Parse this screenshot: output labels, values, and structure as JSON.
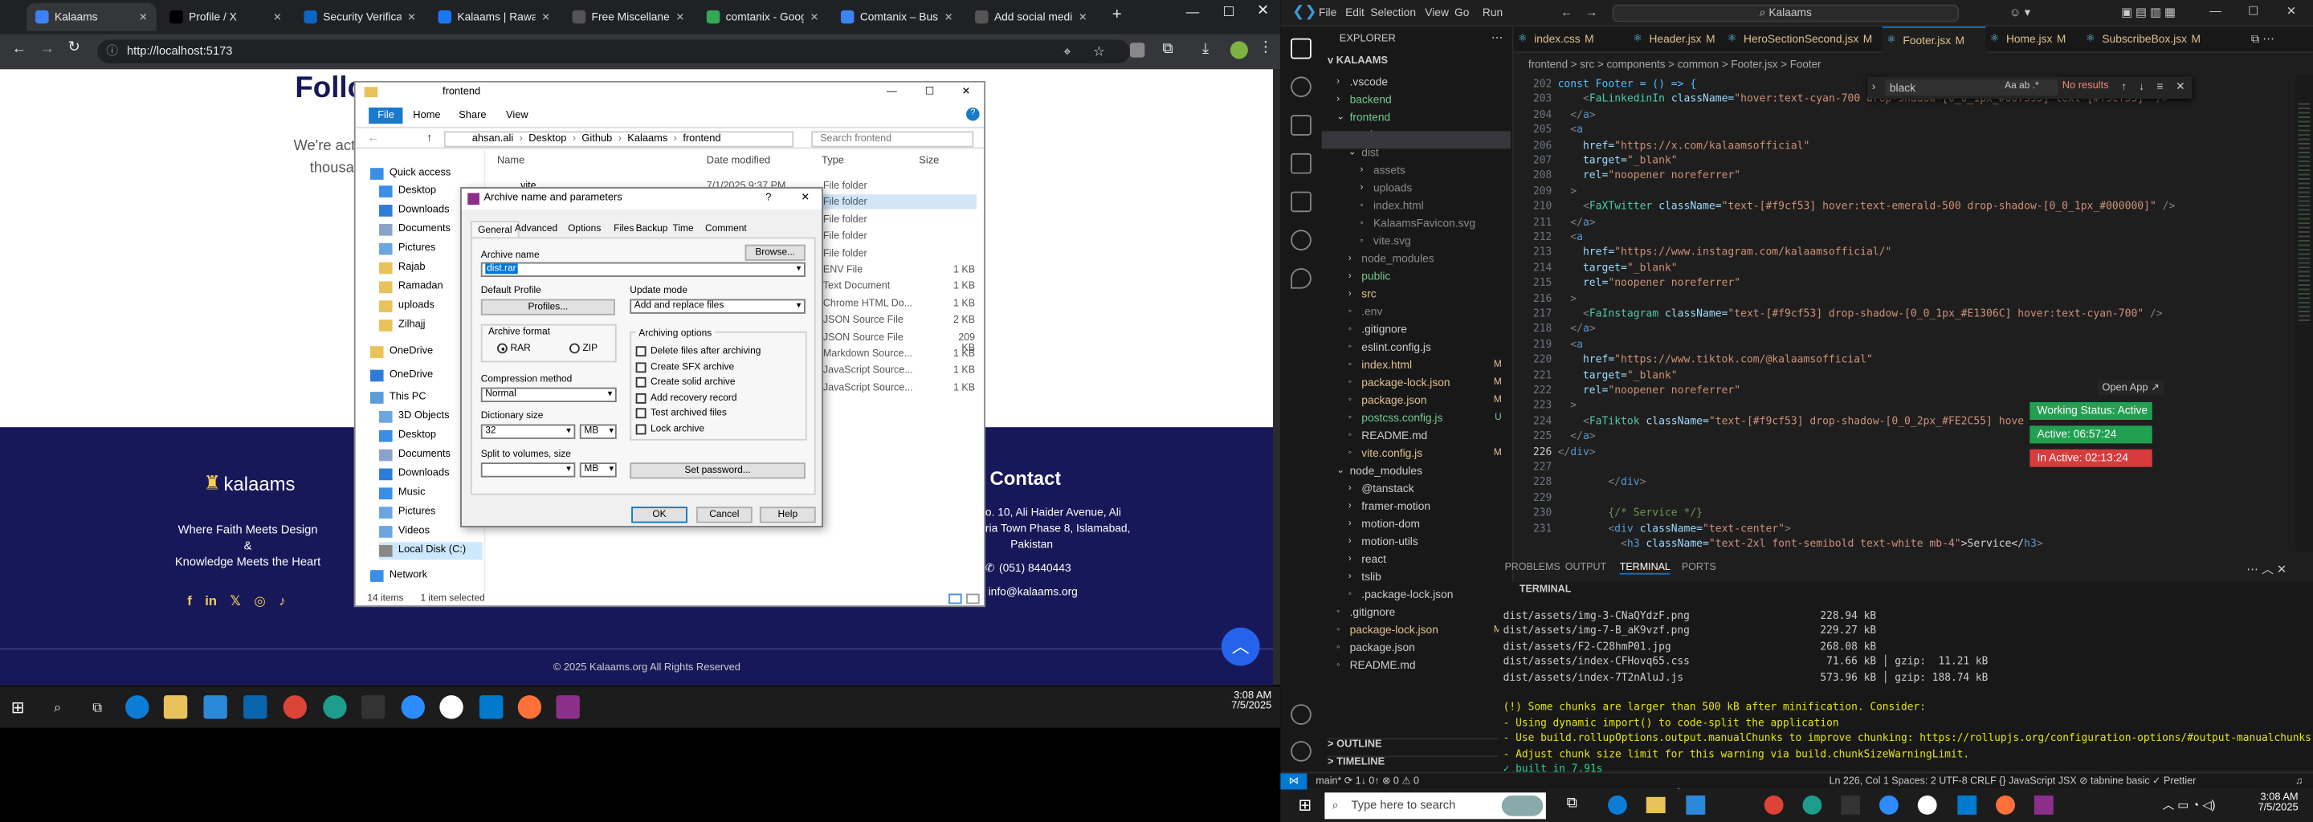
{
  "browser": {
    "tabs": [
      {
        "label": "Kalaams",
        "color": "#3b82f6"
      },
      {
        "label": "Profile / X",
        "color": "#000000"
      },
      {
        "label": "Security Verificati",
        "color": "#0a66c2"
      },
      {
        "label": "Kalaams | Rawalp",
        "color": "#1877f2"
      },
      {
        "label": "Free Miscellaneou",
        "color": "#555555"
      },
      {
        "label": "comtanix - Googl",
        "color": "#34a853"
      },
      {
        "label": "Comtanix – Busin",
        "color": "#3b82f6"
      },
      {
        "label": "Add social media",
        "color": "#555555"
      }
    ],
    "url": "http://localhost:5173",
    "page": {
      "heading_fragment": "Follo",
      "sub_fragment_1": "We're act",
      "sub_fragment_2": "thousa",
      "brand": "kalaams",
      "tagline_1": "Where Faith Meets Design",
      "tagline_2": "&",
      "tagline_3": "Knowledge Meets the Heart",
      "contact_title": "Contact",
      "address_1": "o. 10, Ali Haider Avenue, Ali",
      "address_2": "ria Town Phase 8, Islamabad,",
      "address_3": "Pakistan",
      "phone": "(051) 8440443",
      "email": "info@kalaams.org",
      "copyright": "© 2025 Kalaams.org All Rights Reserved"
    },
    "taskbar": {
      "time": "3:08 AM",
      "date": "7/5/2025"
    }
  },
  "explorer": {
    "title": "frontend",
    "ribbon": [
      "File",
      "Home",
      "Share",
      "View"
    ],
    "path": [
      "ahsan.ali",
      "Desktop",
      "Github",
      "Kalaams",
      "frontend"
    ],
    "search_placeholder": "Search frontend",
    "nav": [
      {
        "label": "Quick access",
        "color": "#3a8ee6"
      },
      {
        "label": "Desktop",
        "color": "#3a8ee6"
      },
      {
        "label": "Downloads",
        "color": "#2f7bd8"
      },
      {
        "label": "Documents",
        "color": "#8aa4c8"
      },
      {
        "label": "Pictures",
        "color": "#6ca6e0"
      },
      {
        "label": "Rajab",
        "color": "#e8c25a"
      },
      {
        "label": "Ramadan",
        "color": "#e8c25a"
      },
      {
        "label": "uploads",
        "color": "#e8c25a"
      },
      {
        "label": "Zilhajj",
        "color": "#e8c25a"
      },
      {
        "label": "OneDrive",
        "color": "#e8c25a"
      },
      {
        "label": "OneDrive",
        "color": "#2f7bd8"
      },
      {
        "label": "This PC",
        "color": "#5a9bd8"
      },
      {
        "label": "3D Objects",
        "color": "#6ca6e0"
      },
      {
        "label": "Desktop",
        "color": "#3a8ee6"
      },
      {
        "label": "Documents",
        "color": "#8aa4c8"
      },
      {
        "label": "Downloads",
        "color": "#2f7bd8"
      },
      {
        "label": "Music",
        "color": "#3a8ee6"
      },
      {
        "label": "Pictures",
        "color": "#6ca6e0"
      },
      {
        "label": "Videos",
        "color": "#6ca6e0"
      },
      {
        "label": "Local Disk (C:)",
        "color": "#888888"
      },
      {
        "label": "Network",
        "color": "#3a8ee6"
      }
    ],
    "columns": [
      "Name",
      "Date modified",
      "Type",
      "Size"
    ],
    "first_row": {
      "name": ".vite",
      "date": "7/1/2025 9:37 PM"
    },
    "types": [
      "File folder",
      "File folder",
      "File folder",
      "File folder",
      "File folder",
      "ENV File",
      "Text Document",
      "Chrome HTML Do...",
      "JSON Source File",
      "JSON Source File",
      "Markdown Source...",
      "JavaScript Source...",
      "JavaScript Source..."
    ],
    "sizes": [
      "",
      "",
      "",
      "",
      "",
      "1 KB",
      "1 KB",
      "1 KB",
      "2 KB",
      "209 KB",
      "1 KB",
      "1 KB",
      "1 KB"
    ],
    "status_items": "14 items",
    "status_selected": "1 item selected"
  },
  "dialog": {
    "title": "Archive name and parameters",
    "tabs": [
      "General",
      "Advanced",
      "Options",
      "Files",
      "Backup",
      "Time",
      "Comment"
    ],
    "archive_name_label": "Archive name",
    "archive_name": "dist.rar",
    "browse": "Browse...",
    "default_profile": "Default Profile",
    "profiles": "Profiles...",
    "update_mode_label": "Update mode",
    "update_mode": "Add and replace files",
    "archive_format_label": "Archive format",
    "format_rar": "RAR",
    "format_zip": "ZIP",
    "compression_label": "Compression method",
    "compression": "Normal",
    "dict_label": "Dictionary size",
    "dict_value": "32",
    "dict_unit": "MB",
    "split_label": "Split to volumes, size",
    "split_unit": "MB",
    "options_label": "Archiving options",
    "options": [
      "Delete files after archiving",
      "Create SFX archive",
      "Create solid archive",
      "Add recovery record",
      "Test archived files",
      "Lock archive"
    ],
    "set_password": "Set password...",
    "ok": "OK",
    "cancel": "Cancel",
    "help": "Help"
  },
  "vscode": {
    "menu": [
      "File",
      "Edit",
      "Selection",
      "View",
      "Go",
      "Run"
    ],
    "search_text": "Kalaams",
    "explorer_title": "EXPLORER",
    "root": "KALAAMS",
    "tree": [
      {
        "label": ".vscode",
        "indent": 1,
        "arrow": ">",
        "color": "#cccccc",
        "badge": ""
      },
      {
        "label": "backend",
        "indent": 1,
        "arrow": ">",
        "color": "#73c991",
        "badge": ""
      },
      {
        "label": "frontend",
        "indent": 1,
        "arrow": "v",
        "color": "#73c991",
        "badge": ""
      },
      {
        "label": ".vite",
        "indent": 2,
        "arrow": ">",
        "color": "#cccccc",
        "badge": ""
      },
      {
        "label": "dist",
        "indent": 2,
        "arrow": "v",
        "color": "#8c8c8c",
        "badge": ""
      },
      {
        "label": "assets",
        "indent": 3,
        "arrow": ">",
        "color": "#8c8c8c",
        "badge": ""
      },
      {
        "label": "uploads",
        "indent": 3,
        "arrow": ">",
        "color": "#8c8c8c",
        "badge": ""
      },
      {
        "label": "index.html",
        "indent": 3,
        "arrow": "",
        "color": "#8c8c8c",
        "badge": ""
      },
      {
        "label": "KalaamsFavicon.svg",
        "indent": 3,
        "arrow": "",
        "color": "#8c8c8c",
        "badge": ""
      },
      {
        "label": "vite.svg",
        "indent": 3,
        "arrow": "",
        "color": "#8c8c8c",
        "badge": ""
      },
      {
        "label": "node_modules",
        "indent": 2,
        "arrow": ">",
        "color": "#8c8c8c",
        "badge": ""
      },
      {
        "label": "public",
        "indent": 2,
        "arrow": ">",
        "color": "#73c991",
        "badge": ""
      },
      {
        "label": "src",
        "indent": 2,
        "arrow": ">",
        "color": "#e2c08d",
        "badge": ""
      },
      {
        "label": ".env",
        "indent": 2,
        "arrow": "",
        "color": "#8c8c8c",
        "badge": ""
      },
      {
        "label": ".gitignore",
        "indent": 2,
        "arrow": "",
        "color": "#cccccc",
        "badge": ""
      },
      {
        "label": "eslint.config.js",
        "indent": 2,
        "arrow": "",
        "color": "#cccccc",
        "badge": ""
      },
      {
        "label": "index.html",
        "indent": 2,
        "arrow": "",
        "color": "#e2c08d",
        "badge": "M"
      },
      {
        "label": "package-lock.json",
        "indent": 2,
        "arrow": "",
        "color": "#e2c08d",
        "badge": "M"
      },
      {
        "label": "package.json",
        "indent": 2,
        "arrow": "",
        "color": "#e2c08d",
        "badge": "M"
      },
      {
        "label": "postcss.config.js",
        "indent": 2,
        "arrow": "",
        "color": "#73c991",
        "badge": "U"
      },
      {
        "label": "README.md",
        "indent": 2,
        "arrow": "",
        "color": "#cccccc",
        "badge": ""
      },
      {
        "label": "vite.config.js",
        "indent": 2,
        "arrow": "",
        "color": "#e2c08d",
        "badge": "M"
      },
      {
        "label": "node_modules",
        "indent": 1,
        "arrow": "v",
        "color": "#cccccc",
        "badge": ""
      },
      {
        "label": "@tanstack",
        "indent": 2,
        "arrow": ">",
        "color": "#cccccc",
        "badge": ""
      },
      {
        "label": "framer-motion",
        "indent": 2,
        "arrow": ">",
        "color": "#cccccc",
        "badge": ""
      },
      {
        "label": "motion-dom",
        "indent": 2,
        "arrow": ">",
        "color": "#cccccc",
        "badge": ""
      },
      {
        "label": "motion-utils",
        "indent": 2,
        "arrow": ">",
        "color": "#cccccc",
        "badge": ""
      },
      {
        "label": "react",
        "indent": 2,
        "arrow": ">",
        "color": "#cccccc",
        "badge": ""
      },
      {
        "label": "tslib",
        "indent": 2,
        "arrow": ">",
        "color": "#cccccc",
        "badge": ""
      },
      {
        "label": ".package-lock.json",
        "indent": 2,
        "arrow": "",
        "color": "#cccccc",
        "badge": ""
      },
      {
        "label": ".gitignore",
        "indent": 1,
        "arrow": "",
        "color": "#cccccc",
        "badge": ""
      },
      {
        "label": "package-lock.json",
        "indent": 1,
        "arrow": "",
        "color": "#e2c08d",
        "badge": "M"
      },
      {
        "label": "package.json",
        "indent": 1,
        "arrow": "",
        "color": "#cccccc",
        "badge": ""
      },
      {
        "label": "README.md",
        "indent": 1,
        "arrow": "",
        "color": "#cccccc",
        "badge": ""
      }
    ],
    "outline": "OUTLINE",
    "timeline": "TIMELINE",
    "editor_tabs": [
      {
        "label": "index.css",
        "badge": "M"
      },
      {
        "label": "Header.jsx",
        "badge": "M"
      },
      {
        "label": "HeroSectionSecond.jsx",
        "badge": "M"
      },
      {
        "label": "Footer.jsx",
        "badge": "M"
      },
      {
        "label": "Home.jsx",
        "badge": "M"
      },
      {
        "label": "SubscribeBox.jsx",
        "badge": "M"
      }
    ],
    "breadcrumb": "frontend > src > components > common > Footer.jsx > Footer",
    "find_text": "black",
    "find_result": "No results",
    "line_numbers": [
      "202",
      "203",
      "204",
      "205",
      "206",
      "207",
      "208",
      "209",
      "210",
      "211",
      "212",
      "213",
      "214",
      "215",
      "216",
      "217",
      "218",
      "219",
      "220",
      "221",
      "222",
      "223",
      "224",
      "225",
      "226",
      "227",
      "228",
      "229",
      "230",
      "231"
    ],
    "code_lines": [
      [
        [
          "const Footer = () => {",
          "#4fc1ff"
        ]
      ],
      [
        [
          "    <",
          "#808080"
        ],
        [
          "FaLinkedinIn ",
          "#4ec9b0"
        ],
        [
          "className=",
          "#9cdcfe"
        ],
        [
          "\"hover:text-cyan-700 drop-shadow-[0_0_1px_#007595] text-[#f9cf53]\"",
          "#ce9178"
        ],
        [
          " />",
          "#808080"
        ]
      ],
      [
        [
          "  </",
          "#808080"
        ],
        [
          "a",
          "#569cd6"
        ],
        [
          ">",
          "#808080"
        ]
      ],
      [
        [
          "  <",
          "#808080"
        ],
        [
          "a",
          "#569cd6"
        ]
      ],
      [
        [
          "    href=",
          "#9cdcfe"
        ],
        [
          "\"https://x.com/kalaamsofficial\"",
          "#ce9178"
        ]
      ],
      [
        [
          "    target=",
          "#9cdcfe"
        ],
        [
          "\"_blank\"",
          "#ce9178"
        ]
      ],
      [
        [
          "    rel=",
          "#9cdcfe"
        ],
        [
          "\"noopener noreferrer\"",
          "#ce9178"
        ]
      ],
      [
        [
          "  >",
          "#808080"
        ]
      ],
      [
        [
          "    <",
          "#808080"
        ],
        [
          "FaXTwitter ",
          "#4ec9b0"
        ],
        [
          "className=",
          "#9cdcfe"
        ],
        [
          "\"text-[#f9cf53] hover:text-emerald-500 drop-shadow-[0_0_1px_#000000]\"",
          "#ce9178"
        ],
        [
          " />",
          "#808080"
        ]
      ],
      [
        [
          "  </",
          "#808080"
        ],
        [
          "a",
          "#569cd6"
        ],
        [
          ">",
          "#808080"
        ]
      ],
      [
        [
          "  <",
          "#808080"
        ],
        [
          "a",
          "#569cd6"
        ]
      ],
      [
        [
          "    href=",
          "#9cdcfe"
        ],
        [
          "\"https://www.instagram.com/kalaamsofficial/\"",
          "#ce9178"
        ]
      ],
      [
        [
          "    target=",
          "#9cdcfe"
        ],
        [
          "\"_blank\"",
          "#ce9178"
        ]
      ],
      [
        [
          "    rel=",
          "#9cdcfe"
        ],
        [
          "\"noopener noreferrer\"",
          "#ce9178"
        ]
      ],
      [
        [
          "  >",
          "#808080"
        ]
      ],
      [
        [
          "    <",
          "#808080"
        ],
        [
          "FaInstagram ",
          "#4ec9b0"
        ],
        [
          "className=",
          "#9cdcfe"
        ],
        [
          "\"text-[#f9cf53] drop-shadow-[0_0_1px_#E1306C] hover:text-cyan-700\"",
          "#ce9178"
        ],
        [
          " />",
          "#808080"
        ]
      ],
      [
        [
          "  </",
          "#808080"
        ],
        [
          "a",
          "#569cd6"
        ],
        [
          ">",
          "#808080"
        ]
      ],
      [
        [
          "  <",
          "#808080"
        ],
        [
          "a",
          "#569cd6"
        ]
      ],
      [
        [
          "    href=",
          "#9cdcfe"
        ],
        [
          "\"https://www.tiktok.com/@kalaamsofficial\"",
          "#ce9178"
        ]
      ],
      [
        [
          "    target=",
          "#9cdcfe"
        ],
        [
          "\"_blank\"",
          "#ce9178"
        ]
      ],
      [
        [
          "    rel=",
          "#9cdcfe"
        ],
        [
          "\"noopener noreferrer\"",
          "#ce9178"
        ]
      ],
      [
        [
          "  >",
          "#808080"
        ]
      ],
      [
        [
          "    <",
          "#808080"
        ],
        [
          "FaTiktok ",
          "#4ec9b0"
        ],
        [
          "className=",
          "#9cdcfe"
        ],
        [
          "\"text-[#f9cf53] drop-shadow-[0_0_2px_#FE2C55] hove",
          "#ce9178"
        ]
      ],
      [
        [
          "  </",
          "#808080"
        ],
        [
          "a",
          "#569cd6"
        ],
        [
          ">",
          "#808080"
        ]
      ],
      [
        [
          "</",
          "#808080"
        ],
        [
          "div",
          "#569cd6"
        ],
        [
          ">",
          "#808080"
        ]
      ],
      [
        [
          "",
          "#d4d4d4"
        ]
      ],
      [
        [
          "        </",
          "#808080"
        ],
        [
          "div",
          "#569cd6"
        ],
        [
          ">",
          "#808080"
        ]
      ],
      [
        [
          "",
          "#d4d4d4"
        ]
      ],
      [
        [
          "        {/* Service */}",
          "#6a9955"
        ]
      ],
      [
        [
          "        <",
          "#808080"
        ],
        [
          "div ",
          "#569cd6"
        ],
        [
          "className=",
          "#9cdcfe"
        ],
        [
          "\"text-center\"",
          "#ce9178"
        ],
        [
          ">",
          "#808080"
        ]
      ],
      [
        [
          "          <",
          "#808080"
        ],
        [
          "h3 ",
          "#569cd6"
        ],
        [
          "className=",
          "#9cdcfe"
        ],
        [
          "\"text-2xl font-semibold text-white mb-4\"",
          "#ce9178"
        ],
        [
          ">Service</",
          "#d4d4d4"
        ],
        [
          "h3",
          "#569cd6"
        ],
        [
          ">",
          "#808080"
        ]
      ]
    ],
    "open_app": "Open App",
    "working_status": "Working Status: Active",
    "active_time": "Active: 06:57:24",
    "inactive_time": "In Active: 02:13:24",
    "panel_tabs": [
      "PROBLEMS",
      "OUTPUT",
      "TERMINAL",
      "PORTS"
    ],
    "terminal_section": "TERMINAL",
    "terminal_lines": [
      {
        "text": "dist/assets/img-3-CNaQYdzF.png                     228.94 kB",
        "color": "#cccccc"
      },
      {
        "text": "dist/assets/img-7-B_aK9vzf.png                     229.27 kB",
        "color": "#cccccc"
      },
      {
        "text": "dist/assets/F2-C28hmP01.jpg                        268.08 kB",
        "color": "#cccccc"
      },
      {
        "text": "dist/assets/index-CFHovq65.css                      71.66 kB │ gzip:  11.21 kB",
        "color": "#cccccc"
      },
      {
        "text": "dist/assets/index-7T2nAluJ.js                      573.96 kB │ gzip: 188.74 kB",
        "color": "#cccccc"
      },
      {
        "text": "",
        "color": "#cccccc"
      },
      {
        "text": "(!) Some chunks are larger than 500 kB after minification. Consider:",
        "color": "#e5e510"
      },
      {
        "text": "- Using dynamic import() to code-split the application",
        "color": "#e5e510"
      },
      {
        "text": "- Use build.rollupOptions.output.manualChunks to improve chunking: https://rollupjs.org/configuration-options/#output-manualchunks",
        "color": "#e5e510"
      },
      {
        "text": "- Adjust chunk size limit for this warning via build.chunkSizeWarningLimit.",
        "color": "#e5e510"
      },
      {
        "text": "✓ built in 7.91s",
        "color": "#23d18b"
      },
      {
        "text": "PS C:\\Users\\ahsan.ali\\Desktop\\Github\\Kalaams\\frontend> ",
        "color": "#cccccc"
      }
    ],
    "status_left": "main*   ⟳ 1↓ 0↑   ⊗ 0 ⚠ 0",
    "status_right": "Ln 226, Col 1   Spaces: 2   UTF-8   CRLF   {} JavaScript JSX   ⊘ tabnine basic   ✓ Prettier",
    "taskbar_search": "Type here to search",
    "taskbar_time": "3:08 AM",
    "taskbar_date": "7/5/2025"
  }
}
